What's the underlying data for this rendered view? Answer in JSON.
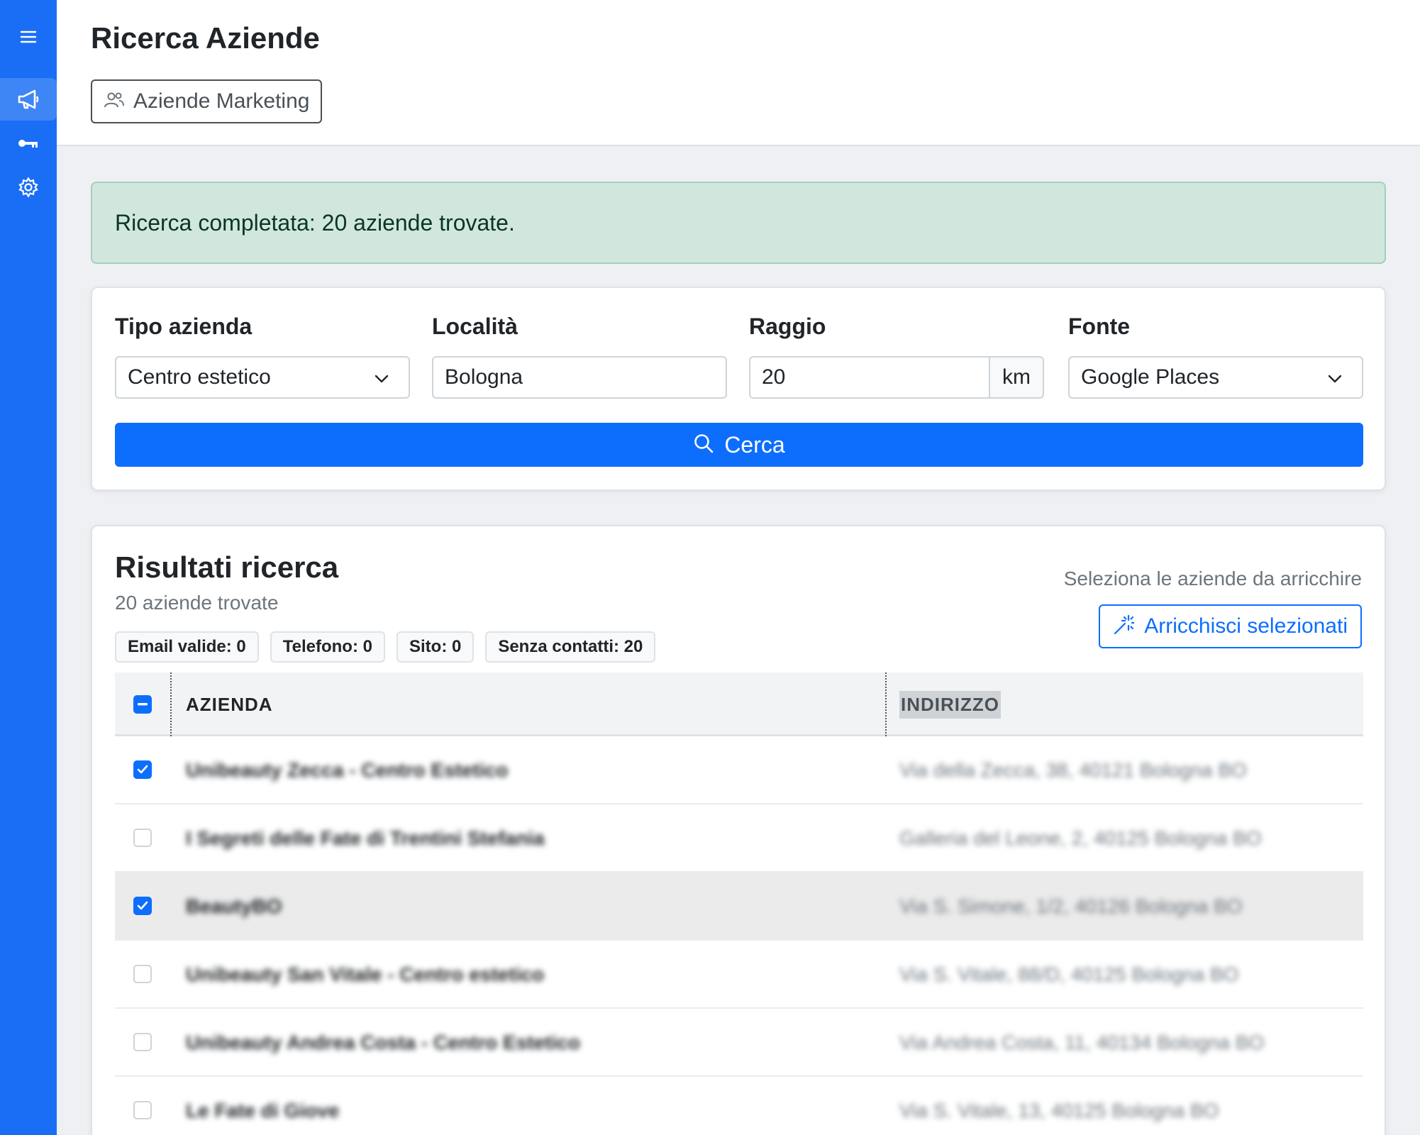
{
  "sidebar": {
    "items": [
      {
        "icon": "menu-icon"
      },
      {
        "icon": "megaphone-icon",
        "active": true
      },
      {
        "icon": "key-icon"
      },
      {
        "icon": "gear-icon"
      }
    ]
  },
  "header": {
    "title": "Ricerca Aziende",
    "tab_label": "Aziende Marketing",
    "tab_icon": "users-icon"
  },
  "alert": {
    "message": "Ricerca completata: 20 aziende trovate."
  },
  "search": {
    "type_label": "Tipo azienda",
    "type_value": "Centro estetico",
    "location_label": "Località",
    "location_value": "Bologna",
    "radius_label": "Raggio",
    "radius_value": "20",
    "radius_unit": "km",
    "source_label": "Fonte",
    "source_value": "Google Places",
    "button_label": "Cerca"
  },
  "results": {
    "title": "Risultati ricerca",
    "subtitle": "20 aziende trovate",
    "hint": "Seleziona le aziende da arricchire",
    "enrich_label": "Arricchisci selezionati",
    "badges": [
      "Email valide: 0",
      "Telefono: 0",
      "Sito: 0",
      "Senza contatti: 20"
    ],
    "columns": [
      "AZIENDA",
      "INDIRIZZO"
    ],
    "rows": [
      {
        "name": "Unibeauty Zecca - Centro Estetico",
        "address": "Via della Zecca, 38, 40121 Bologna BO",
        "checked": true
      },
      {
        "name": "I Segreti delle Fate di Trentini Stefania",
        "address": "Galleria del Leone, 2, 40125 Bologna BO",
        "checked": false
      },
      {
        "name": "BeautyBO",
        "address": "Via S. Simone, 1/2, 40126 Bologna BO",
        "checked": true
      },
      {
        "name": "Unibeauty San Vitale - Centro estetico",
        "address": "Via S. Vitale, 88/D, 40125 Bologna BO",
        "checked": false
      },
      {
        "name": "Unibeauty Andrea Costa - Centro Estetico",
        "address": "Via Andrea Costa, 11, 40134 Bologna BO",
        "checked": false
      },
      {
        "name": "Le Fate di Giove",
        "address": "Via S. Vitale, 13, 40125 Bologna BO",
        "checked": false
      }
    ]
  },
  "colors": {
    "sidebar": "#1a6ef5",
    "primary": "#0d6efd",
    "alert_bg": "#d1e7dd",
    "alert_text": "#0a3622"
  }
}
